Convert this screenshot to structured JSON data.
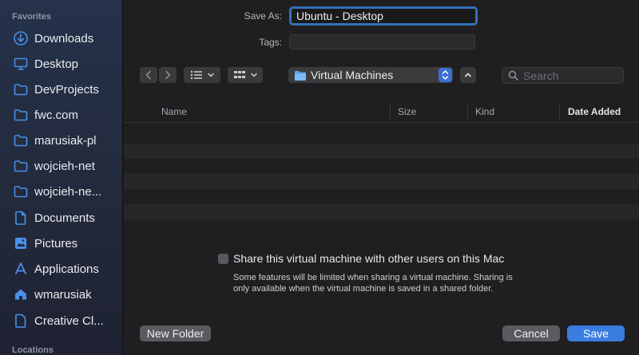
{
  "sidebar": {
    "favorites_heading": "Favorites",
    "locations_heading": "Locations",
    "items": [
      {
        "label": "Downloads",
        "icon": "downloads-icon"
      },
      {
        "label": "Desktop",
        "icon": "desktop-icon"
      },
      {
        "label": "DevProjects",
        "icon": "folder-icon"
      },
      {
        "label": "fwc.com",
        "icon": "folder-icon"
      },
      {
        "label": "marusiak-pl",
        "icon": "folder-icon"
      },
      {
        "label": "wojcieh-net",
        "icon": "folder-icon"
      },
      {
        "label": "wojcieh-ne...",
        "icon": "folder-icon"
      },
      {
        "label": "Documents",
        "icon": "documents-icon"
      },
      {
        "label": "Pictures",
        "icon": "pictures-icon"
      },
      {
        "label": "Applications",
        "icon": "applications-icon"
      },
      {
        "label": "wmarusiak",
        "icon": "home-icon"
      },
      {
        "label": "Creative Cl...",
        "icon": "file-icon"
      }
    ]
  },
  "form": {
    "save_as_label": "Save As:",
    "save_as_value": "Ubuntu - Desktop",
    "tags_label": "Tags:"
  },
  "toolbar": {
    "location": "Virtual Machines",
    "search_placeholder": "Search"
  },
  "table": {
    "columns": [
      "Name",
      "Size",
      "Kind",
      "Date Added"
    ],
    "sorted_column": "Date Added"
  },
  "options": {
    "share_label": "Share this virtual machine with other users on this Mac",
    "note": "Some features will be limited when sharing a virtual machine. Sharing is only available when the virtual machine is saved in a shared folder."
  },
  "buttons": {
    "new_folder": "New Folder",
    "cancel": "Cancel",
    "save": "Save"
  },
  "colors": {
    "accent": "#3a7de0",
    "sidebar_icon": "#4a90e8"
  }
}
